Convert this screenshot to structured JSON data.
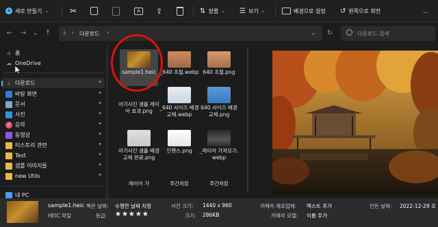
{
  "toolbar": {
    "new_label": "새로 만들기",
    "sort_label": "정렬",
    "view_label": "보기",
    "set_bg_label": "배경으로 설정",
    "rotate_left_label": "왼쪽으로 회전",
    "more_label": "…"
  },
  "address": {
    "path_label": "다운로드",
    "search_placeholder": "다운로드 검색"
  },
  "sidebar": {
    "items": [
      {
        "label": "홈",
        "icon": "home-icon"
      },
      {
        "label": "OneDrive",
        "icon": "cloud-icon"
      },
      {
        "label": "다운로드",
        "icon": "download-icon",
        "selected": true
      },
      {
        "label": "바탕 화면",
        "icon": "desktop-icon"
      },
      {
        "label": "문서",
        "icon": "document-icon"
      },
      {
        "label": "사진",
        "icon": "pictures-icon"
      },
      {
        "label": "음악",
        "icon": "music-icon"
      },
      {
        "label": "동영상",
        "icon": "video-icon"
      },
      {
        "label": "티스토리 관련",
        "icon": "folder-icon"
      },
      {
        "label": "Test",
        "icon": "folder-icon"
      },
      {
        "label": "샘플 이미지들",
        "icon": "folder-icon"
      },
      {
        "label": "new Utils",
        "icon": "folder-icon"
      },
      {
        "label": "내 PC",
        "icon": "pc-icon"
      }
    ]
  },
  "files": [
    {
      "label": "sample1.heic",
      "selected": true
    },
    {
      "label": "_640 조절.webp"
    },
    {
      "label": "640 조절.png"
    },
    {
      "label": "_640 사이즈 배경 교체.webp"
    },
    {
      "label": "640 사이즈 배경 교체.png"
    },
    {
      "label": "아기사진 샘플 레이어 효과.png"
    },
    {
      "label": "아기사진 샘플 배경 교체 완료.png"
    },
    {
      "label": "인핸스.png"
    },
    {
      "label": "_레이어 가져오기.webp"
    },
    {
      "label": "레이어 가"
    },
    {
      "label": "주간저장"
    },
    {
      "label": "주간저장"
    }
  ],
  "status": {
    "filename": "sample1.heic",
    "filetype": "HEIC 파일",
    "shot_date_label": "찍은 날짜:",
    "shot_date_value": "수행한 날짜 지정",
    "rating_label": "등급:",
    "rating_value": "★★★★★",
    "photo_size_label": "사진 크기:",
    "photo_size_value": "1440 x 960",
    "size_label": "크기:",
    "size_value": "286KB",
    "maker_label": "카메라 제조업체:",
    "maker_value": "텍스트 추가",
    "model_label": "카메라 모델:",
    "model_value": "이름 추가",
    "created_label": "만든 날짜:",
    "created_value": "2022-12-29 오"
  },
  "colors": {
    "accent": "#4cc2ff",
    "selection_ring": "#e01010"
  }
}
